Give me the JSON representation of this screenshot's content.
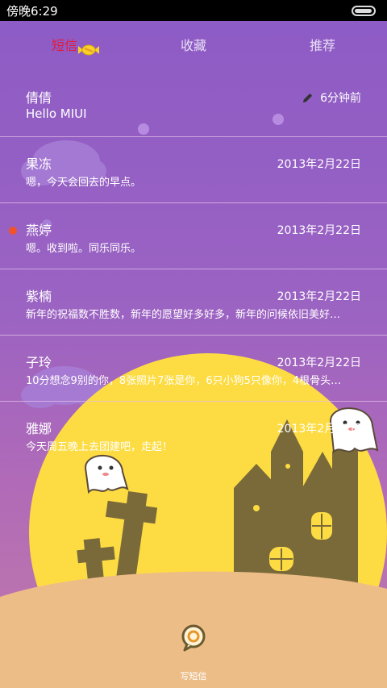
{
  "status_bar": {
    "time": "傍晚6:29"
  },
  "tabs": [
    {
      "label": "短信",
      "active": true
    },
    {
      "label": "收藏",
      "active": false
    },
    {
      "label": "推荐",
      "active": false
    }
  ],
  "messages": [
    {
      "name": "倩倩",
      "time": "6分钟前",
      "preview": "Hello MIUI",
      "draft": true,
      "unread": false
    },
    {
      "name": "果冻",
      "time": "2013年2月22日",
      "preview": "嗯，今天会回去的早点。",
      "draft": false,
      "unread": false
    },
    {
      "name": "燕婷",
      "time": "2013年2月22日",
      "preview": "嗯。收到啦。同乐同乐。",
      "draft": false,
      "unread": true
    },
    {
      "name": "紫楠",
      "time": "2013年2月22日",
      "preview": "新年的祝福数不胜数，新年的愿望好多好多，新年的问候依旧美好…",
      "draft": false,
      "unread": false
    },
    {
      "name": "子玲",
      "time": "2013年2月22日",
      "preview": "10分想念9别的你，8张照片7张是你，6只小狗5只像你，4根骨头…",
      "draft": false,
      "unread": false
    },
    {
      "name": "雅娜",
      "time": "2013年2月22日",
      "preview": "今天周五晚上去团建吧，走起！",
      "draft": false,
      "unread": false
    }
  ],
  "compose": {
    "label": "写短信"
  },
  "colors": {
    "active_tab": "#e21b3c",
    "unread_dot": "#f0532c",
    "moon": "#fddc43",
    "ground": "#edbd88"
  }
}
